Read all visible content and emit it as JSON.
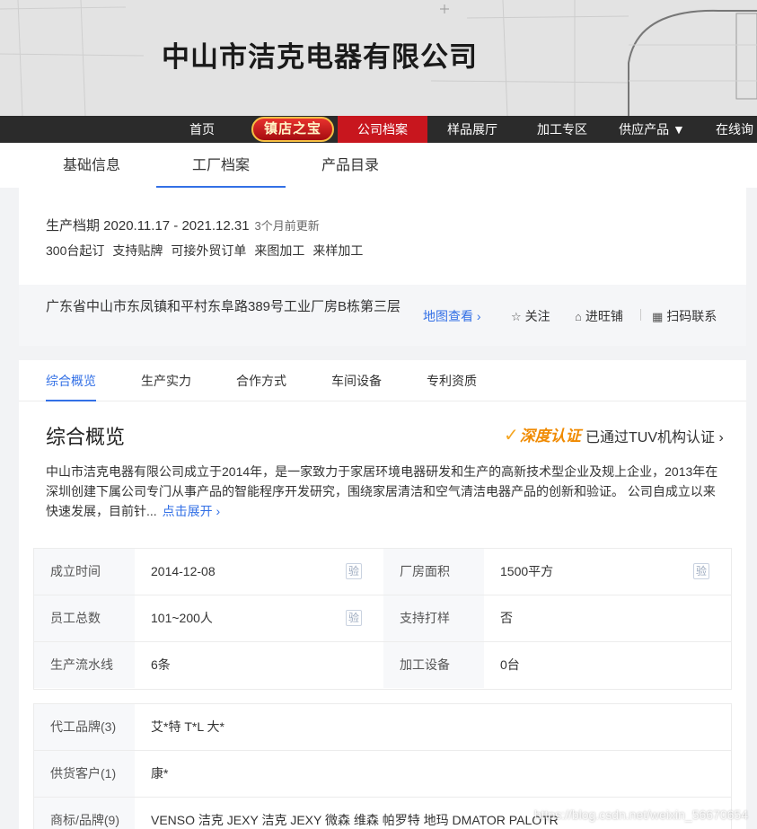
{
  "header": {
    "company_name": "中山市洁克电器有限公司"
  },
  "nav": {
    "items": [
      "首页",
      "公司档案",
      "样品展厅",
      "加工专区",
      "供应产品 ▼",
      "在线询"
    ],
    "badge": "镇店之宝"
  },
  "subtabs": [
    "基础信息",
    "工厂档案",
    "产品目录"
  ],
  "production": {
    "period": "生产档期 2020.11.17 - 2021.12.31",
    "updated": "3个月前更新",
    "tags": [
      "300台起订",
      "支持贴牌",
      "可接外贸订单",
      "来图加工",
      "来样加工"
    ]
  },
  "address": {
    "text": "广东省中山市东凤镇和平村东阜路389号工业厂房B栋第三层",
    "map_link": "地图查看 ›",
    "follow": "关注",
    "wangpu": "进旺铺",
    "scan": "扫码联系"
  },
  "content_tabs": [
    "综合概览",
    "生产实力",
    "合作方式",
    "车间设备",
    "专利资质"
  ],
  "overview": {
    "title": "综合概览",
    "cert_logo": "深度认证",
    "cert_text": "已通过TUV机构认证 ›",
    "description": "中山市洁克电器有限公司成立于2014年，是一家致力于家居环境电器研发和生产的高新技术型企业及规上企业，2013年在深圳创建下属公司专门从事产品的智能程序开发研究，围绕家居清洁和空气清洁电器产品的创新和验证。 公司自成立以来快速发展，目前针...",
    "more": "点击展开 ›"
  },
  "info": {
    "verify_badge": "验",
    "rows": [
      {
        "l1": "成立时间",
        "v1": "2014-12-08",
        "l2": "厂房面积",
        "v2": "1500平方"
      },
      {
        "l1": "员工总数",
        "v1": "101~200人",
        "l2": "支持打样",
        "v2": "否"
      },
      {
        "l1": "生产流水线",
        "v1": "6条",
        "l2": "加工设备",
        "v2": "0台"
      }
    ],
    "rows2": [
      {
        "label": "代工品牌(3)",
        "value": "艾*特 T*L 大*"
      },
      {
        "label": "供货客户(1)",
        "value": "康*"
      },
      {
        "label": "商标/品牌(9)",
        "value": "VENSO 洁克 JEXY 洁克 JEXY 微森 维森 帕罗特 地玛 DMATOR PALOTR"
      }
    ]
  },
  "watermark": "https://blog.csdn.net/weixin_56670654"
}
